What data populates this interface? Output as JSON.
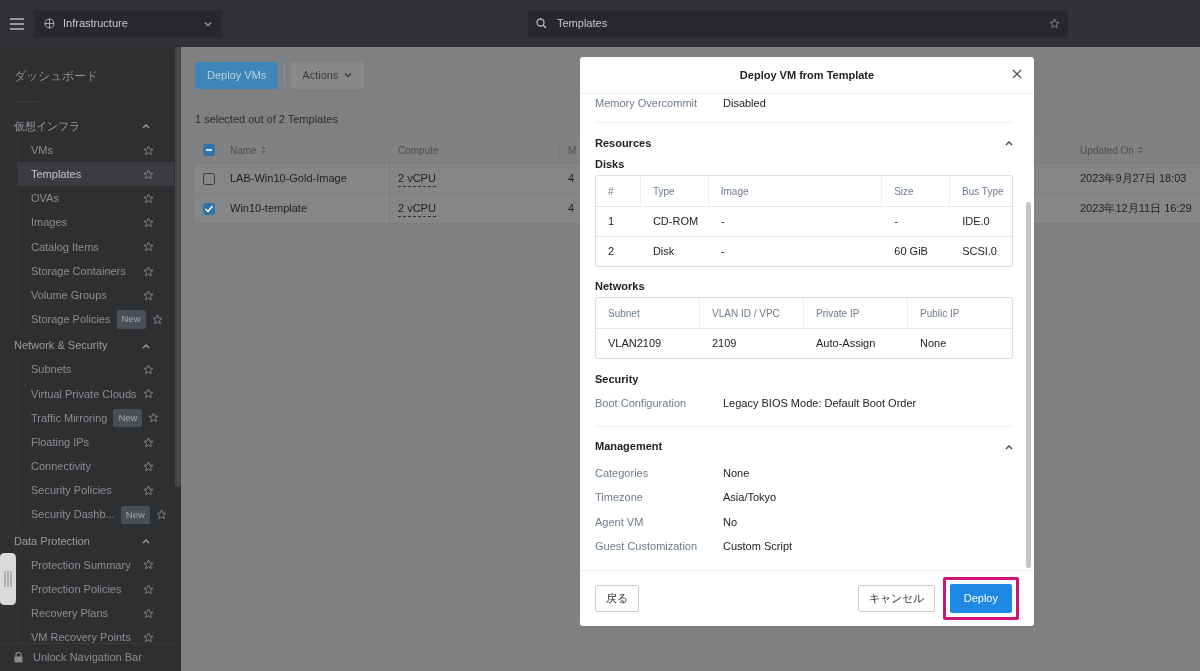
{
  "top_bar": {
    "app_selector": "Infrastructure",
    "search": {
      "value": "Templates"
    }
  },
  "sidebar": {
    "dashboard": "ダッシュボード",
    "sections": [
      {
        "title": "仮想インフラ",
        "expanded": true,
        "items": [
          {
            "label": "VMs",
            "selected": false
          },
          {
            "label": "Templates",
            "selected": true
          },
          {
            "label": "OVAs",
            "selected": false
          },
          {
            "label": "Images",
            "selected": false
          },
          {
            "label": "Catalog Items",
            "selected": false
          },
          {
            "label": "Storage Containers",
            "selected": false
          },
          {
            "label": "Volume Groups",
            "selected": false
          },
          {
            "label": "Storage Policies",
            "selected": false,
            "badge": "New"
          }
        ]
      },
      {
        "title": "Network & Security",
        "expanded": true,
        "items": [
          {
            "label": "Subnets",
            "selected": false
          },
          {
            "label": "Virtual Private Clouds",
            "selected": false
          },
          {
            "label": "Traffic Mirroring",
            "selected": false,
            "badge": "New"
          },
          {
            "label": "Floating IPs",
            "selected": false
          },
          {
            "label": "Connectivity",
            "selected": false
          },
          {
            "label": "Security Policies",
            "selected": false
          },
          {
            "label": "Security Dashb...",
            "selected": false,
            "badge": "New"
          }
        ]
      },
      {
        "title": "Data Protection",
        "expanded": true,
        "items": [
          {
            "label": "Protection Summary",
            "selected": false
          },
          {
            "label": "Protection Policies",
            "selected": false
          },
          {
            "label": "Recovery Plans",
            "selected": false
          },
          {
            "label": "VM Recovery Points",
            "selected": false
          }
        ]
      }
    ],
    "footer": "Unlock Navigation Bar"
  },
  "toolbar": {
    "primary": "Deploy VMs",
    "actions": "Actions"
  },
  "selection_summary": "1 selected out of 2 Templates",
  "table": {
    "header_checked": true,
    "header_indeterminate": true,
    "columns": [
      {
        "label": "Name",
        "sortable": true
      },
      {
        "label": "Compute",
        "sortable": false
      },
      {
        "label": "M",
        "sortable": false
      },
      {
        "label": "Updated On",
        "sortable": true
      }
    ],
    "rows": [
      {
        "checked": false,
        "cells": [
          "LAB-Win10-Gold-Image",
          "2 vCPU",
          "4",
          "2023年9月27日 18:03"
        ]
      },
      {
        "checked": true,
        "cells": [
          "Win10-template",
          "2 vCPU",
          "4",
          "2023年12月11日 16:29"
        ]
      }
    ]
  },
  "dialog": {
    "title": "Deploy VM from Template",
    "top_fields": [
      {
        "label": "Memory Overcommit",
        "value": "Disabled"
      }
    ],
    "resources": {
      "title": "Resources",
      "expanded": true,
      "disks": {
        "title": "Disks",
        "columns": [
          "#",
          "Type",
          "Image",
          "Size",
          "Bus Type"
        ],
        "rows": [
          [
            "1",
            "CD-ROM",
            "-",
            "-",
            "IDE.0"
          ],
          [
            "2",
            "Disk",
            "-",
            "60 GiB",
            "SCSI.0"
          ]
        ]
      },
      "networks": {
        "title": "Networks",
        "columns": [
          "Subnet",
          "VLAN ID / VPC",
          "Private IP",
          "Public IP"
        ],
        "rows": [
          [
            "VLAN2109",
            "2109",
            "Auto-Assign",
            "None"
          ]
        ]
      }
    },
    "security": {
      "title": "Security",
      "fields": [
        {
          "label": "Boot Configuration",
          "value": "Legacy BIOS Mode: Default Boot Order"
        }
      ]
    },
    "management": {
      "title": "Management",
      "expanded": true,
      "fields": [
        {
          "label": "Categories",
          "value": "None"
        },
        {
          "label": "Timezone",
          "value": "Asia/Tokyo"
        },
        {
          "label": "Agent VM",
          "value": "No"
        },
        {
          "label": "Guest Customization",
          "value": "Custom Script"
        }
      ]
    },
    "buttons": [
      {
        "label": "戻る",
        "kind": "back",
        "highlighted": false
      },
      {
        "label": "キャンセル",
        "kind": "cancel",
        "highlighted": false
      },
      {
        "label": "Deploy",
        "kind": "primary",
        "highlighted": true
      }
    ]
  }
}
